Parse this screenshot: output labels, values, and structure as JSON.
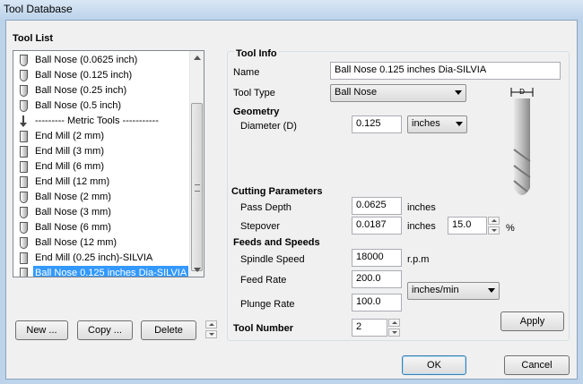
{
  "window": {
    "title": "Tool Database"
  },
  "tool_list": {
    "label": "Tool List",
    "items": [
      {
        "label": "Ball Nose (0.0625 inch)",
        "icon": "ball-nose-icon"
      },
      {
        "label": "Ball Nose (0.125 inch)",
        "icon": "ball-nose-icon"
      },
      {
        "label": "Ball Nose (0.25 inch)",
        "icon": "ball-nose-icon"
      },
      {
        "label": "Ball Nose (0.5 inch)",
        "icon": "ball-nose-icon"
      },
      {
        "label": "--------- Metric Tools -----------",
        "icon": "divider-arrow-icon"
      },
      {
        "label": "End Mill (2 mm)",
        "icon": "end-mill-icon"
      },
      {
        "label": "End Mill (3 mm)",
        "icon": "end-mill-icon"
      },
      {
        "label": "End Mill (6 mm)",
        "icon": "end-mill-icon"
      },
      {
        "label": "End Mill (12 mm)",
        "icon": "end-mill-icon"
      },
      {
        "label": "Ball Nose (2 mm)",
        "icon": "ball-nose-icon"
      },
      {
        "label": "Ball Nose (3 mm)",
        "icon": "ball-nose-icon"
      },
      {
        "label": "Ball Nose (6 mm)",
        "icon": "ball-nose-icon"
      },
      {
        "label": "Ball Nose (12 mm)",
        "icon": "ball-nose-icon"
      },
      {
        "label": "End Mill (0.25 inch)-SILVIA",
        "icon": "end-mill-icon"
      },
      {
        "label": "Ball Nose 0.125 inches Dia-SILVIA",
        "icon": "ball-nose-icon",
        "selected": true
      }
    ],
    "buttons": {
      "new": "New ...",
      "copy": "Copy ...",
      "delete": "Delete"
    }
  },
  "tool_info": {
    "section": "Tool Info",
    "name_label": "Name",
    "name_value": "Ball Nose 0.125 inches Dia-SILVIA",
    "type_label": "Tool Type",
    "type_value": "Ball Nose",
    "diagram_dim": "D"
  },
  "geometry": {
    "section": "Geometry",
    "diameter_label": "Diameter (D)",
    "diameter_value": "0.125",
    "units_value": "inches"
  },
  "cutting": {
    "section": "Cutting Parameters",
    "pass_depth_label": "Pass Depth",
    "pass_depth_value": "0.0625",
    "pass_depth_unit": "inches",
    "stepover_label": "Stepover",
    "stepover_value": "0.0187",
    "stepover_unit": "inches",
    "stepover_percent": "15.0",
    "percent_sign": "%"
  },
  "feeds": {
    "section": "Feeds and Speeds",
    "spindle_label": "Spindle Speed",
    "spindle_value": "18000",
    "spindle_unit": "r.p.m",
    "feed_label": "Feed Rate",
    "feed_value": "200.0",
    "plunge_label": "Plunge Rate",
    "plunge_value": "100.0",
    "rate_units": "inches/min"
  },
  "tool_number": {
    "label": "Tool Number",
    "value": "2"
  },
  "apply_label": "Apply",
  "ok_label": "OK",
  "cancel_label": "Cancel"
}
